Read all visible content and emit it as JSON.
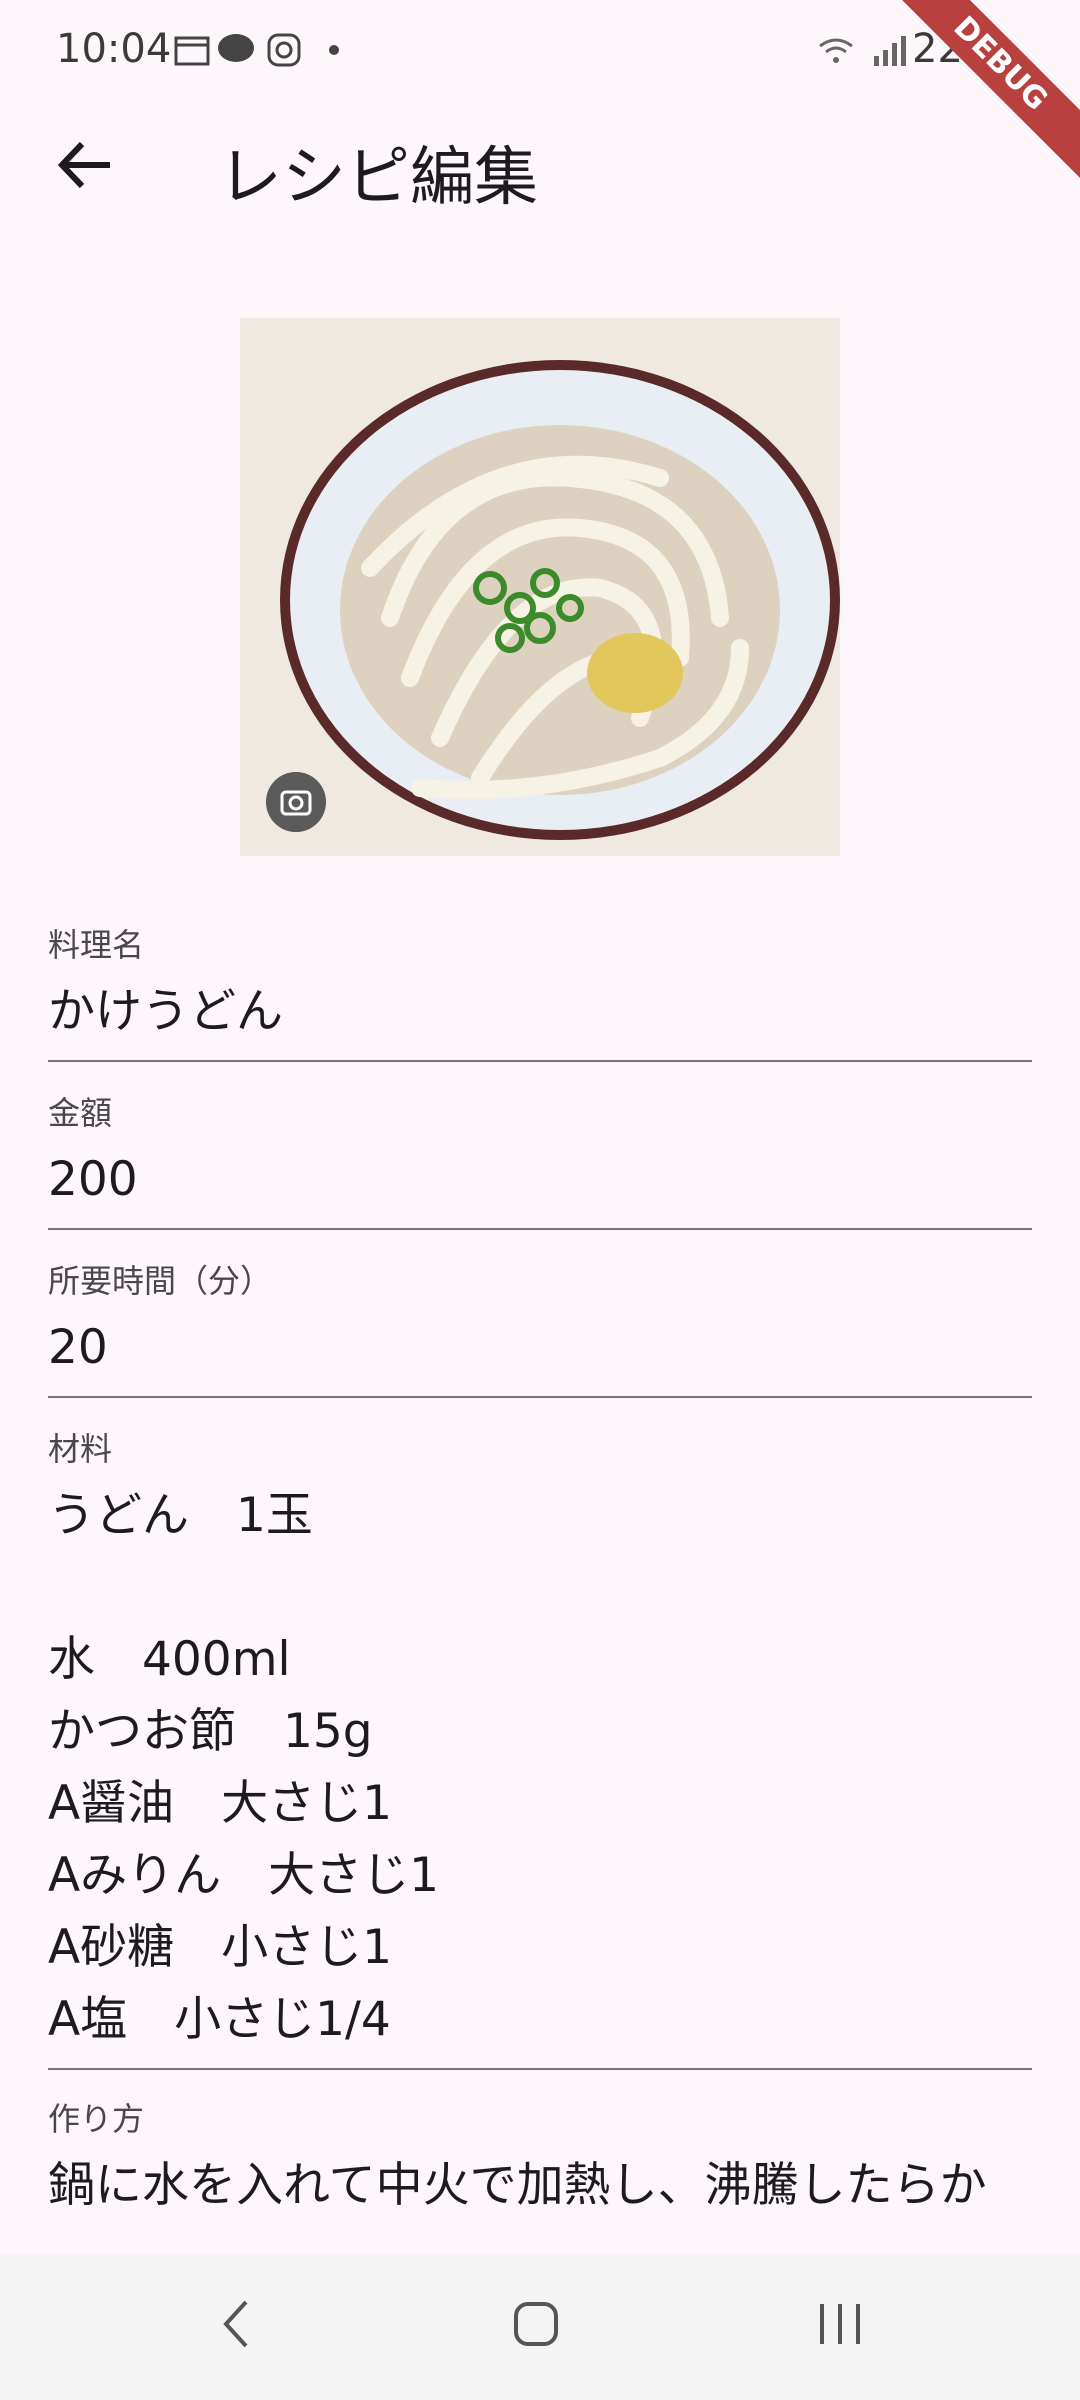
{
  "status_bar": {
    "time": "10:04",
    "battery": "22%",
    "debug_banner": "DEBUG"
  },
  "app_bar": {
    "title": "レシピ編集"
  },
  "fields": {
    "name": {
      "label": "料理名",
      "value": "かけうどん"
    },
    "price": {
      "label": "金額",
      "value": "200"
    },
    "time": {
      "label": "所要時間（分）",
      "value": "20"
    },
    "ingredients": {
      "label": "材料",
      "lines": [
        "うどん　1玉",
        "",
        "水　400ml",
        "かつお節　15g",
        "A醤油　大さじ1",
        "Aみりん　大さじ1",
        "A砂糖　小さじ1",
        "A塩　小さじ1/4"
      ]
    },
    "method": {
      "label": "作り方",
      "value": "鍋に水を入れて中火で加熱し、沸騰したらか"
    }
  },
  "icons": {
    "back": "arrow-left-icon",
    "camera": "camera-icon"
  }
}
